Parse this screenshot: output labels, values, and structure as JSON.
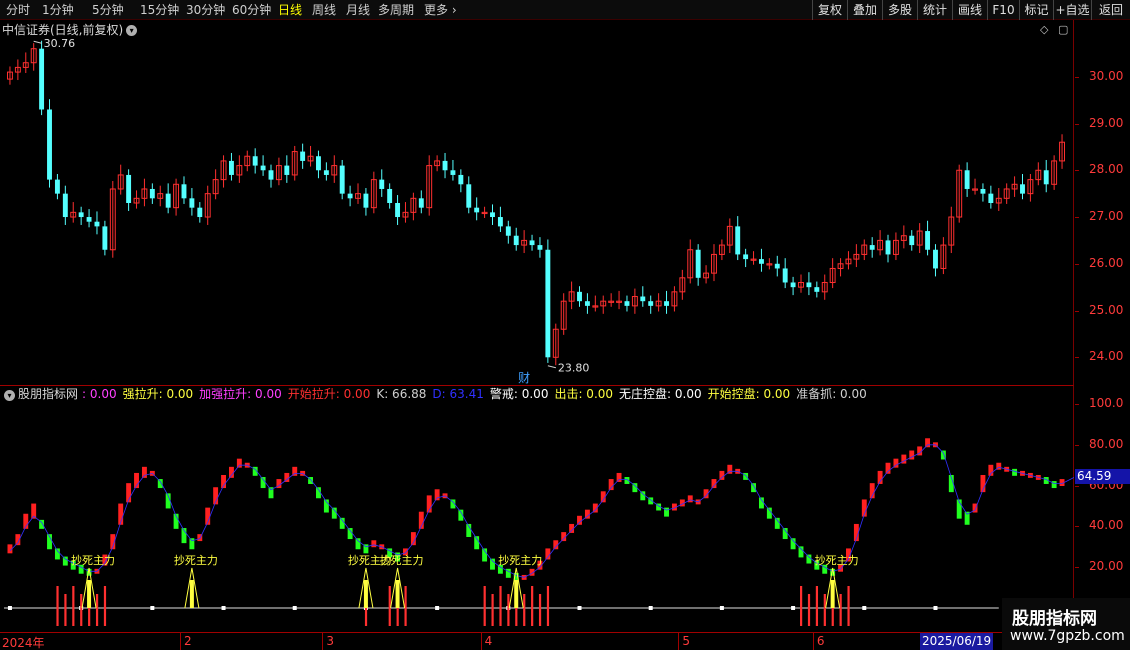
{
  "toolbar": {
    "periods": [
      "分时",
      "1分钟",
      "5分钟",
      "15分钟",
      "30分钟",
      "60分钟",
      "日线",
      "周线",
      "月线",
      "多周期",
      "更多"
    ],
    "active_period": "日线",
    "right_buttons": [
      "复权",
      "叠加",
      "多股",
      "统计",
      "画线",
      "F10",
      "标记",
      "+自选",
      "返回"
    ]
  },
  "main_panel": {
    "title": "中信证券(日线,前复权)",
    "high_label": "30.76",
    "low_label": "23.80",
    "cai_marker": "财"
  },
  "indicator": {
    "name": "股朋指标网",
    "items": [
      {
        "label": "",
        "value": "0.00",
        "color": "#ff40ff"
      },
      {
        "label": "强拉升",
        "value": "0.00",
        "color": "#ffff40"
      },
      {
        "label": "加强拉升",
        "value": "0.00",
        "color": "#ff40ff"
      },
      {
        "label": "开始拉升",
        "value": "0.00",
        "color": "#ff3030"
      },
      {
        "label": "K",
        "value": "66.88",
        "color": "#d0d0d0"
      },
      {
        "label": "D",
        "value": "63.41",
        "color": "#3030ff"
      },
      {
        "label": "警戒",
        "value": "0.00",
        "color": "#ffffff"
      },
      {
        "label": "出击",
        "value": "0.00",
        "color": "#ffff40"
      },
      {
        "label": "无庄控盘",
        "value": "0.00",
        "color": "#ffffff"
      },
      {
        "label": "开始控盘",
        "value": "0.00",
        "color": "#ffff40"
      },
      {
        "label": "准备抓",
        "value": "0.00",
        "color": "#d0d0d0"
      }
    ],
    "signal_label": "抄死主力",
    "current_value": "64.59"
  },
  "price_axis": [
    "30.00",
    "29.00",
    "28.00",
    "27.00",
    "26.00",
    "25.00",
    "24.00"
  ],
  "indicator_axis": [
    "100.0",
    "80.00",
    "60.00",
    "40.00",
    "20.00"
  ],
  "time_axis": {
    "labels": [
      "2024年",
      "2",
      "3",
      "4",
      "5",
      "6"
    ],
    "current_date": "2025/06/19"
  },
  "watermark": {
    "title": "股朋指标网",
    "url": "www.7gpzb.com"
  },
  "colors": {
    "up": "#ff3030",
    "down": "#54ffff",
    "kdj_up": "#ff2020",
    "kdj_down": "#20ff20",
    "signal": "#ffff40",
    "accent_red": "#a00000"
  },
  "chart_data": {
    "type": "candlestick",
    "price_ylim": [
      23.6,
      31.0
    ],
    "indicator_ylim": [
      0,
      100
    ],
    "closes": [
      30.1,
      30.2,
      30.3,
      30.6,
      29.3,
      27.8,
      27.5,
      27.0,
      27.1,
      27.0,
      26.9,
      26.8,
      26.3,
      27.6,
      27.9,
      27.3,
      27.4,
      27.6,
      27.4,
      27.5,
      27.2,
      27.7,
      27.4,
      27.2,
      27.0,
      27.5,
      27.8,
      28.2,
      27.9,
      28.1,
      28.3,
      28.1,
      28.0,
      27.8,
      28.1,
      27.9,
      28.4,
      28.2,
      28.3,
      28.0,
      27.9,
      28.1,
      27.5,
      27.4,
      27.5,
      27.2,
      27.8,
      27.6,
      27.3,
      27.0,
      27.1,
      27.4,
      27.2,
      28.1,
      28.2,
      28.0,
      27.9,
      27.7,
      27.2,
      27.1,
      27.1,
      27.0,
      26.8,
      26.6,
      26.4,
      26.5,
      26.4,
      26.3,
      24.0,
      24.6,
      25.2,
      25.4,
      25.2,
      25.1,
      25.1,
      25.2,
      25.2,
      25.2,
      25.1,
      25.3,
      25.2,
      25.1,
      25.2,
      25.1,
      25.4,
      25.7,
      26.3,
      25.7,
      25.8,
      26.2,
      26.4,
      26.8,
      26.2,
      26.1,
      26.1,
      26.0,
      26.0,
      25.9,
      25.6,
      25.5,
      25.6,
      25.5,
      25.4,
      25.6,
      25.9,
      26.0,
      26.1,
      26.2,
      26.4,
      26.3,
      26.5,
      26.2,
      26.5,
      26.6,
      26.4,
      26.7,
      26.3,
      25.9,
      26.4,
      27.0,
      28.0,
      27.6,
      27.6,
      27.5,
      27.3,
      27.4,
      27.6,
      27.7,
      27.5,
      27.8,
      28.0,
      27.7,
      28.2,
      28.6
    ],
    "kdj_k": [
      30,
      35,
      45,
      50,
      40,
      30,
      25,
      22,
      20,
      18,
      17,
      18,
      25,
      35,
      50,
      60,
      65,
      68,
      66,
      60,
      50,
      40,
      33,
      30,
      35,
      48,
      58,
      64,
      68,
      72,
      70,
      66,
      60,
      55,
      62,
      65,
      68,
      66,
      62,
      55,
      48,
      45,
      40,
      35,
      30,
      28,
      32,
      30,
      26,
      24,
      28,
      36,
      46,
      54,
      57,
      55,
      50,
      44,
      36,
      30,
      24,
      20,
      18,
      16,
      14,
      15,
      18,
      22,
      28,
      32,
      36,
      40,
      44,
      47,
      50,
      56,
      62,
      65,
      62,
      58,
      54,
      52,
      49,
      46,
      50,
      52,
      54,
      52,
      57,
      62,
      66,
      69,
      67,
      64,
      58,
      50,
      45,
      40,
      35,
      30,
      26,
      23,
      20,
      18,
      17,
      20,
      28,
      40,
      52,
      60,
      66,
      70,
      72,
      74,
      76,
      78,
      82,
      80,
      74,
      58,
      45,
      42,
      50,
      64,
      69,
      70,
      68,
      66,
      66,
      65,
      64,
      62,
      60,
      62,
      64,
      66
    ],
    "kdj_d": [
      28,
      32,
      40,
      45,
      42,
      35,
      28,
      24,
      22,
      20,
      18,
      18,
      22,
      30,
      42,
      53,
      60,
      65,
      66,
      62,
      55,
      45,
      38,
      33,
      34,
      42,
      52,
      60,
      65,
      70,
      70,
      68,
      63,
      58,
      60,
      63,
      66,
      66,
      63,
      58,
      52,
      48,
      43,
      38,
      33,
      30,
      31,
      30,
      28,
      26,
      27,
      32,
      40,
      48,
      54,
      55,
      52,
      47,
      40,
      34,
      28,
      23,
      20,
      18,
      16,
      15,
      17,
      20,
      25,
      30,
      34,
      38,
      42,
      45,
      48,
      53,
      59,
      63,
      63,
      60,
      56,
      53,
      50,
      48,
      49,
      51,
      53,
      52,
      55,
      60,
      64,
      67,
      67,
      65,
      60,
      53,
      48,
      43,
      38,
      33,
      29,
      25,
      22,
      20,
      18,
      19,
      24,
      34,
      46,
      55,
      62,
      67,
      70,
      72,
      74,
      76,
      80,
      80,
      76,
      64,
      52,
      46,
      48,
      58,
      66,
      69,
      68,
      67,
      66,
      65,
      64,
      63,
      61,
      61,
      63,
      65
    ]
  }
}
